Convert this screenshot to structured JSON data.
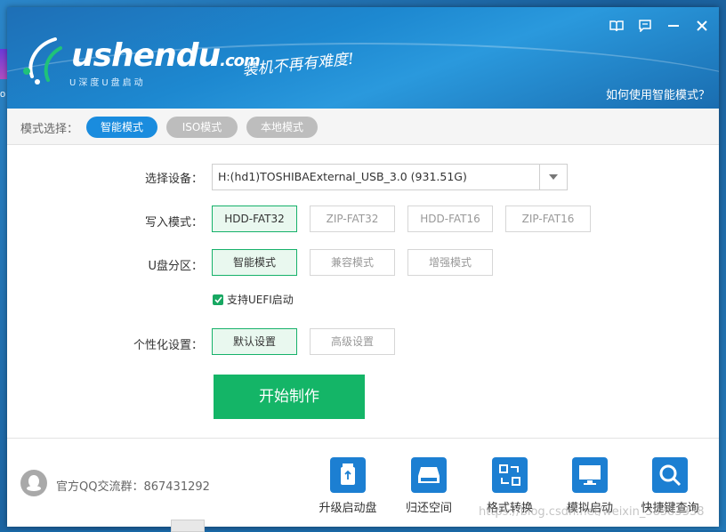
{
  "header": {
    "logo_text": "ushendu",
    "logo_suffix": ".com",
    "logo_sub": "U深度U盘启动",
    "slogan": "装机不再有难度!",
    "help_link": "如何使用智能模式？"
  },
  "desktop": {
    "partial_letter": "o"
  },
  "mode_bar": {
    "label": "模式选择：",
    "modes": [
      {
        "label": "智能模式",
        "active": true
      },
      {
        "label": "ISO模式",
        "active": false
      },
      {
        "label": "本地模式",
        "active": false
      }
    ]
  },
  "form": {
    "device_label": "选择设备：",
    "device_value": "H:(hd1)TOSHIBAExternal_USB_3.0 (931.51G)",
    "write_mode_label": "写入模式：",
    "write_modes": [
      "HDD-FAT32",
      "ZIP-FAT32",
      "HDD-FAT16",
      "ZIP-FAT16"
    ],
    "partition_label": "U盘分区：",
    "partitions": [
      "智能模式",
      "兼容模式",
      "增强模式"
    ],
    "uefi_label": "支持UEFI启动",
    "uefi_checked": true,
    "personal_label": "个性化设置：",
    "personal_options": [
      "默认设置",
      "高级设置"
    ],
    "start_button": "开始制作"
  },
  "footer": {
    "qq_group": "官方QQ交流群：867431292",
    "tools": [
      {
        "label": "升级启动盘",
        "icon": "upgrade-icon"
      },
      {
        "label": "归还空间",
        "icon": "disk-icon"
      },
      {
        "label": "格式转换",
        "icon": "convert-icon"
      },
      {
        "label": "模拟启动",
        "icon": "monitor-icon"
      },
      {
        "label": "快捷键查询",
        "icon": "search-icon"
      }
    ],
    "watermark": "https://blog.csdn.net/weixin_38383338"
  },
  "colors": {
    "accent": "#1a8cde",
    "green": "#14b567",
    "tool_blue": "#1c7fd2"
  }
}
